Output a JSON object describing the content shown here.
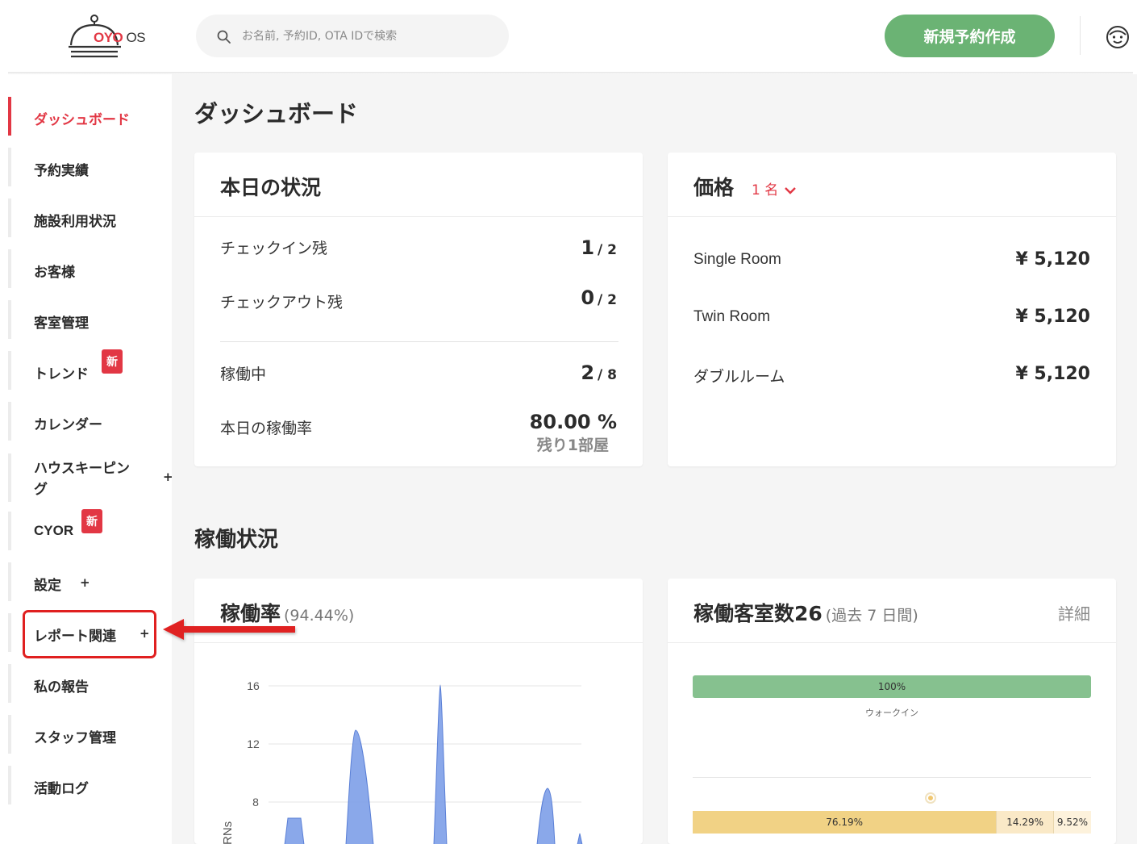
{
  "header": {
    "logo": {
      "brand": "OYO",
      "suffix": "OS"
    },
    "search": {
      "placeholder": "お名前, 予約ID, OTA IDで検索",
      "value": ""
    },
    "new_booking_label": "新規予約作成"
  },
  "sidebar": {
    "items": [
      {
        "label": "ダッシュボード",
        "active": true
      },
      {
        "label": "予約実績"
      },
      {
        "label": "施設利用状況"
      },
      {
        "label": "お客様"
      },
      {
        "label": "客室管理"
      },
      {
        "label": "トレンド",
        "badge": "新"
      },
      {
        "label": "カレンダー"
      },
      {
        "label": "ハウスキーピング",
        "label_line1": "ハウスキーピン",
        "label_line2": "グ",
        "expand": "+"
      },
      {
        "label": "CYOR",
        "badge": "新"
      },
      {
        "label": "設定",
        "expand": "+"
      },
      {
        "label": "レポート関連",
        "expand": "+",
        "highlighted": true
      },
      {
        "label": "私の報告"
      },
      {
        "label": "スタッフ管理"
      },
      {
        "label": "活動ログ"
      }
    ]
  },
  "main": {
    "page_title": "ダッシュボード",
    "today": {
      "title": "本日の状況",
      "rows": [
        {
          "label": "チェックイン残",
          "value": "1",
          "total": "/ 2"
        },
        {
          "label": "チェックアウト残",
          "value": "0",
          "total": "/ 2"
        },
        {
          "label": "稼働中",
          "value": "2",
          "total": "/ 8"
        },
        {
          "label": "本日の稼働率",
          "value": "80.00 %",
          "sub": "残り1部屋"
        }
      ]
    },
    "price": {
      "title": "価格",
      "filter": "1 名",
      "rows": [
        {
          "room": "Single Room",
          "price": "¥ 5,120"
        },
        {
          "room": "Twin Room",
          "price": "¥ 5,120"
        },
        {
          "room": "ダブルルーム",
          "price": "¥ 5,120"
        }
      ]
    },
    "section_title": "稼働状況",
    "occupancy_rate": {
      "title": "稼働率",
      "subtitle": "(94.44%)",
      "y_axis_label": "RNs",
      "y_ticks": [
        "16",
        "12",
        "8"
      ]
    },
    "occupied_rooms": {
      "title": "稼働客室数26",
      "subtitle": "(過去 7 日間)",
      "detail_label": "詳細",
      "source_bar": {
        "percent_label": "100%",
        "percent": 100,
        "caption": "ウォークイン"
      },
      "stacked_bar": [
        {
          "label": "76.19%",
          "percent": 76.19
        },
        {
          "label": "14.29%",
          "percent": 14.29
        },
        {
          "label": "9.52%",
          "percent": 9.52
        }
      ]
    }
  },
  "colors": {
    "brand_red": "#e23744",
    "primary_green": "#6bb374",
    "bar_green": "#86c18f",
    "chart_blue": "#7d9ee8",
    "stack_yellow": "#f1d285",
    "stack_light": "#fae9c7",
    "annotation_red": "#e02020"
  }
}
